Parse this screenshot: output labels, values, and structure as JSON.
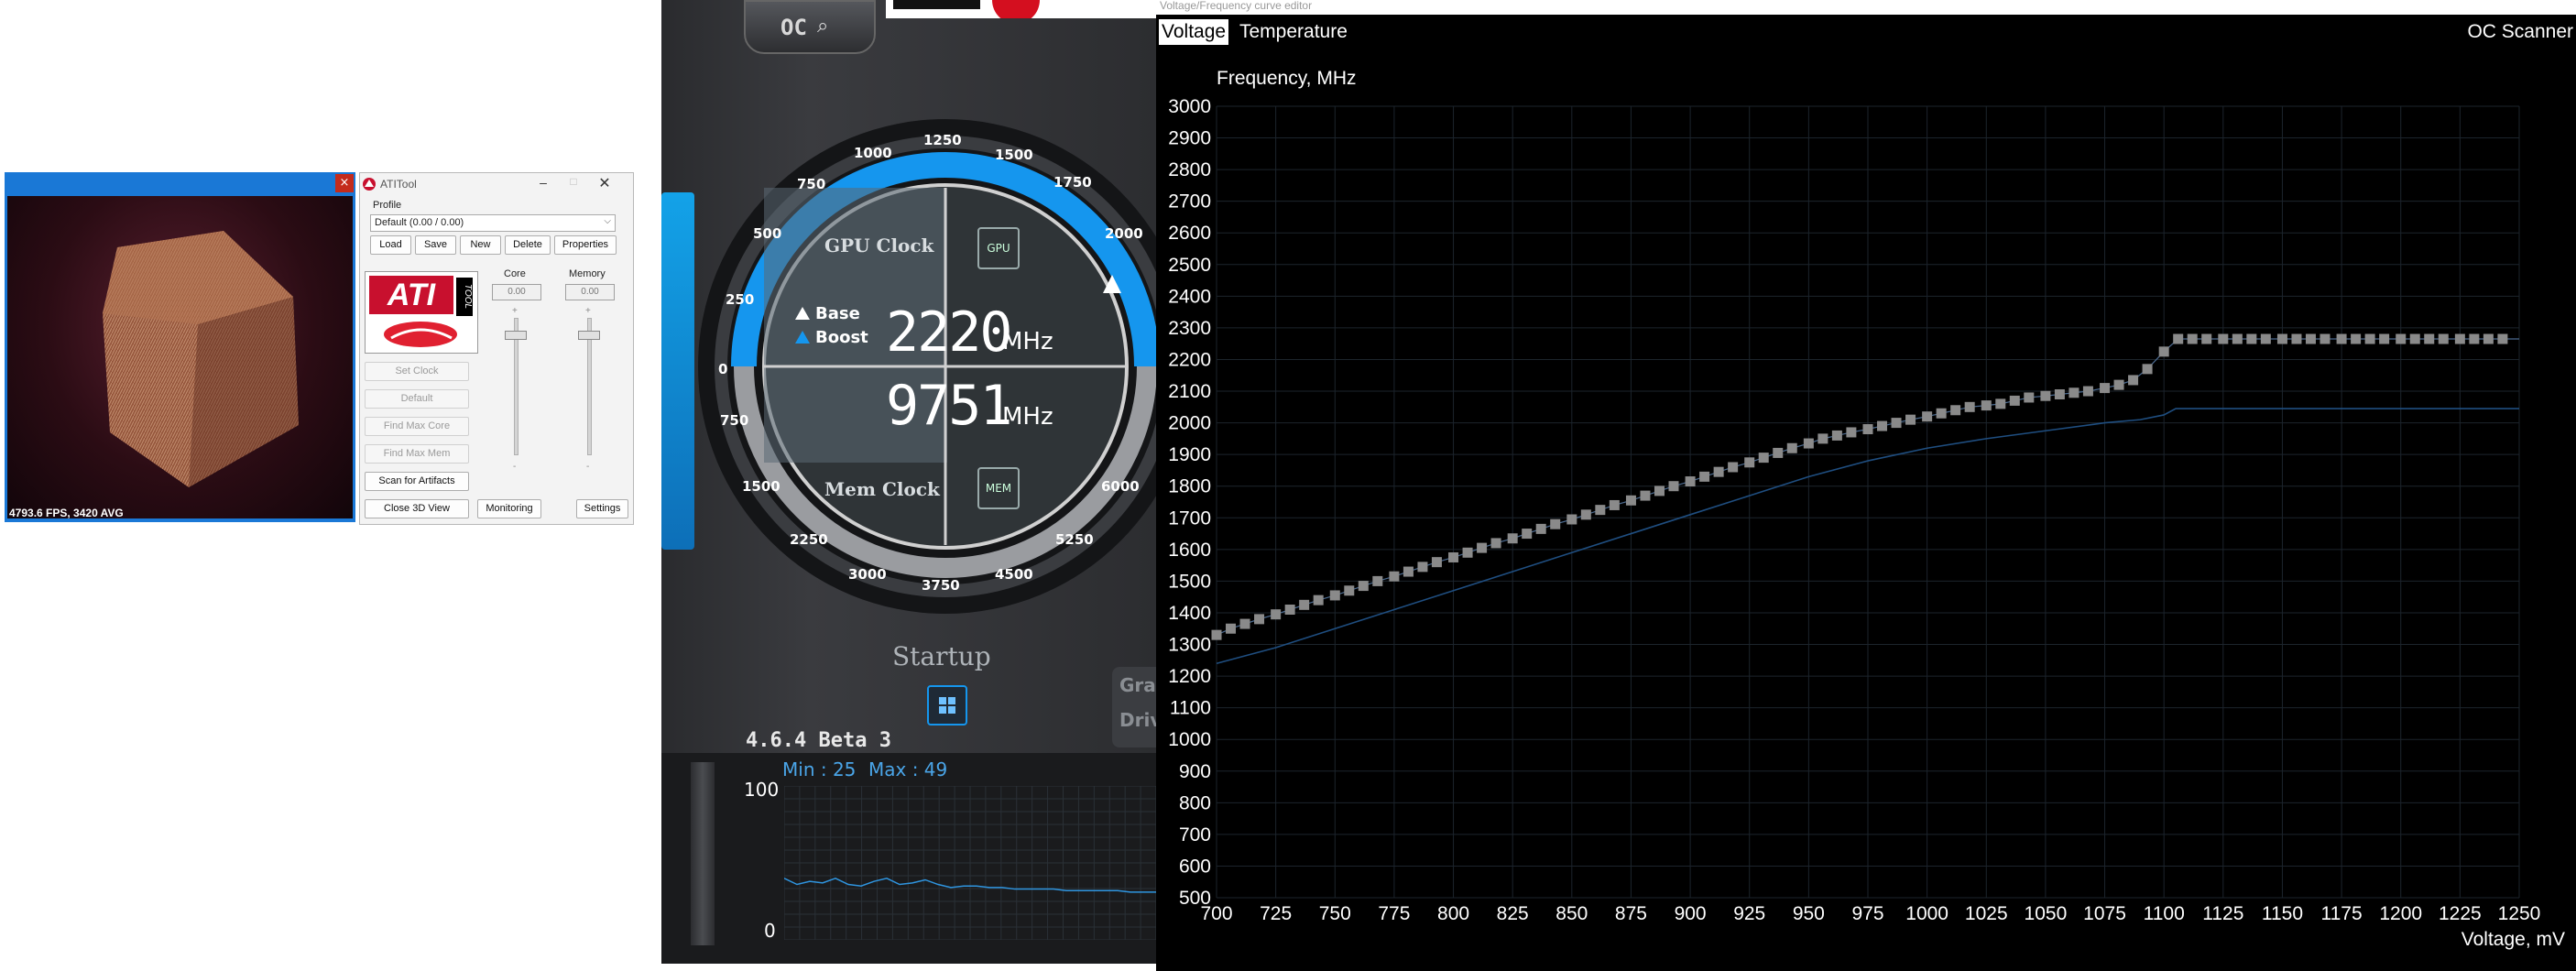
{
  "fur": {
    "close_glyph": "×",
    "fps": "4793.6 FPS, 3420 AVG"
  },
  "atitool": {
    "title": "ATITool",
    "profile_label": "Profile",
    "profile_value": "Default (0.00 / 0.00)",
    "buttons": {
      "load": "Load",
      "save": "Save",
      "new": "New",
      "delete": "Delete",
      "properties": "Properties"
    },
    "logo_text": "ATI",
    "logo_sub": "TOOL",
    "core_label": "Core",
    "memory_label": "Memory",
    "core_value": "0.00",
    "memory_value": "0.00",
    "plus": "+",
    "minus": "-",
    "side_buttons": {
      "set_clock": "Set Clock",
      "default": "Default",
      "find_max_core": "Find Max Core",
      "find_max_mem": "Find Max Mem",
      "scan": "Scan for Artifacts",
      "close_3d": "Close 3D View",
      "monitoring": "Monitoring",
      "settings": "Settings"
    }
  },
  "afterburner": {
    "oc_label": "OC",
    "gpu_clock_label": "GPU Clock",
    "gpu_chip": "GPU",
    "base_label": "Base",
    "boost_label": "Boost",
    "core_mhz": "2220",
    "core_unit": "MHz",
    "mem_mhz": "9751",
    "mem_unit": "MHz",
    "mem_clock_label": "Mem Clock",
    "mem_chip": "MEM",
    "outer_ticks": [
      "0",
      "250",
      "500",
      "750",
      "1000",
      "1250",
      "1500",
      "1750",
      "2000"
    ],
    "lower_ticks": [
      "750",
      "1500",
      "2250",
      "3000",
      "3750",
      "4500",
      "5250",
      "6000"
    ],
    "startup_label": "Startup",
    "version": "4.6.4 Beta 3",
    "graph_min": "Min : 25",
    "graph_max": "Max : 49",
    "graph_top": "100",
    "graph_bottom": "0",
    "side_tab_1": "Gra",
    "side_tab_2": "Driv",
    "monitor_values": [
      40,
      36,
      38,
      37,
      40,
      36,
      35,
      38,
      40,
      36,
      37,
      39,
      36,
      34,
      35,
      35,
      34,
      34,
      33,
      33,
      33,
      33,
      32,
      32,
      32,
      32,
      32,
      31,
      31,
      31
    ]
  },
  "vf_editor": {
    "title": "Voltage/Frequency curve editor",
    "tabs": {
      "voltage": "Voltage",
      "temperature": "Temperature",
      "oc_scanner": "OC Scanner"
    },
    "colors": {
      "curve": "#8a8a8a",
      "reference": "#1f4e80",
      "grid": "#1c242c"
    },
    "chart_data": {
      "type": "scatter",
      "ylabel": "Frequency, MHz",
      "xlabel": "Voltage, mV",
      "xlim": [
        700,
        1250
      ],
      "ylim": [
        500,
        3000
      ],
      "x_ticks": [
        700,
        725,
        750,
        775,
        800,
        825,
        850,
        875,
        900,
        925,
        950,
        975,
        1000,
        1025,
        1050,
        1075,
        1100,
        1125,
        1150,
        1175,
        1200,
        1225,
        1250
      ],
      "y_ticks": [
        500,
        600,
        700,
        800,
        900,
        1000,
        1100,
        1200,
        1300,
        1400,
        1500,
        1600,
        1700,
        1800,
        1900,
        2000,
        2100,
        2200,
        2300,
        2400,
        2500,
        2600,
        2700,
        2800,
        2900,
        3000
      ],
      "series": [
        {
          "x": [
            700,
            706,
            712,
            718,
            725,
            731,
            737,
            743,
            750,
            756,
            762,
            768,
            775,
            781,
            787,
            793,
            800,
            806,
            812,
            818,
            825,
            831,
            837,
            843,
            850,
            856,
            862,
            868,
            875,
            881,
            887,
            893,
            900,
            906,
            912,
            918,
            925,
            931,
            937,
            943,
            950,
            956,
            962,
            968,
            975,
            981,
            987,
            993,
            1000,
            1006,
            1012,
            1018,
            1025,
            1031,
            1037,
            1043,
            1050,
            1056,
            1062,
            1068,
            1075,
            1081,
            1087,
            1093,
            1100,
            1106,
            1112,
            1118,
            1125,
            1131,
            1137,
            1143,
            1150,
            1156,
            1162,
            1168,
            1175,
            1181,
            1187,
            1193,
            1200,
            1206,
            1212,
            1218,
            1225,
            1231,
            1237,
            1243
          ],
          "y": [
            1330,
            1350,
            1365,
            1380,
            1395,
            1410,
            1425,
            1440,
            1455,
            1470,
            1485,
            1500,
            1515,
            1530,
            1545,
            1560,
            1575,
            1590,
            1605,
            1620,
            1635,
            1650,
            1665,
            1680,
            1695,
            1710,
            1725,
            1740,
            1755,
            1770,
            1785,
            1800,
            1815,
            1830,
            1845,
            1860,
            1875,
            1890,
            1905,
            1920,
            1935,
            1950,
            1960,
            1970,
            1980,
            1990,
            2000,
            2010,
            2020,
            2030,
            2040,
            2050,
            2055,
            2060,
            2070,
            2080,
            2085,
            2090,
            2095,
            2100,
            2110,
            2120,
            2135,
            2170,
            2225,
            2265,
            2265,
            2265,
            2265,
            2265,
            2265,
            2265,
            2265,
            2265,
            2265,
            2265,
            2265,
            2265,
            2265,
            2265,
            2265,
            2265,
            2265,
            2265,
            2265,
            2265,
            2265,
            2265
          ]
        },
        {
          "x": [
            700,
            725,
            750,
            775,
            800,
            825,
            850,
            875,
            900,
            925,
            950,
            975,
            1000,
            1025,
            1050,
            1075,
            1090,
            1100,
            1105,
            1125,
            1150,
            1175,
            1200,
            1225,
            1250
          ],
          "y": [
            1240,
            1290,
            1350,
            1410,
            1470,
            1530,
            1590,
            1650,
            1710,
            1770,
            1830,
            1880,
            1920,
            1950,
            1975,
            2000,
            2010,
            2025,
            2045,
            2045,
            2045,
            2045,
            2045,
            2045,
            2045
          ]
        }
      ]
    }
  }
}
